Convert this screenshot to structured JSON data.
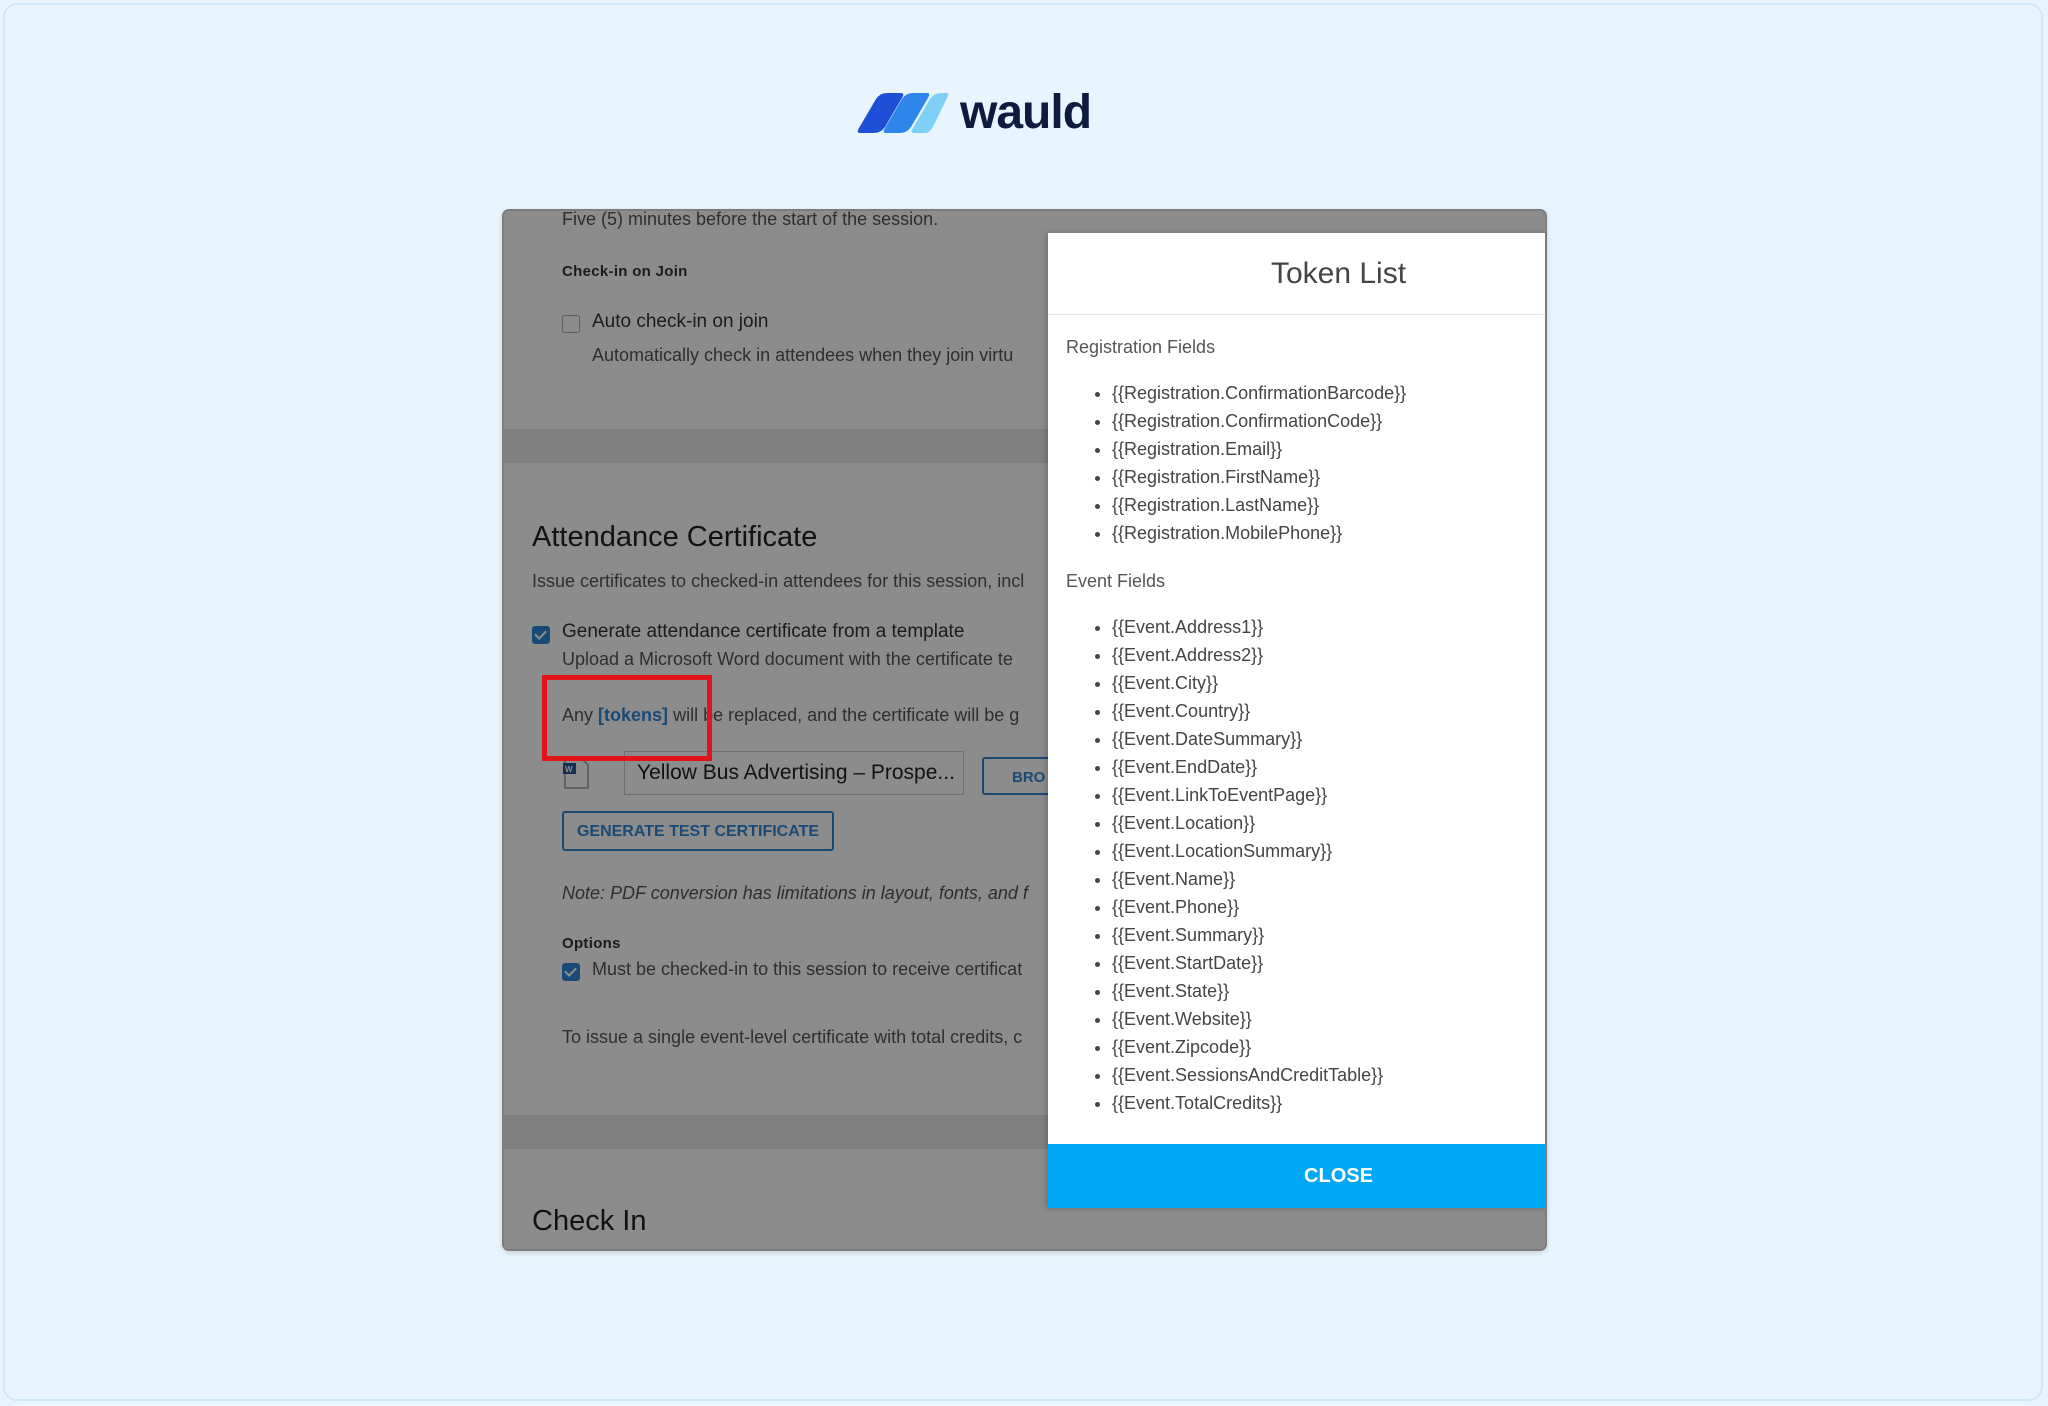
{
  "logo": {
    "text": "wauld"
  },
  "background": {
    "session_note": "Five (5) minutes before the start of the session.",
    "checkin_on_join_label": "Check-in on Join",
    "auto_checkin_label": "Auto check-in on join",
    "auto_checkin_desc": "Automatically check in attendees when they join virtu",
    "attendance_heading": "Attendance Certificate",
    "attendance_desc": "Issue certificates to checked-in attendees for this session, incl",
    "generate_template_label": "Generate attendance certificate from a template",
    "upload_desc": "Upload a Microsoft Word document with the certificate te",
    "tokens_any": "Any",
    "tokens_link": "[tokens]",
    "tokens_rest": "will be replaced, and the certificate will be g",
    "file_name": "Yellow Bus Advertising – Prospe...",
    "browse_label": "BRO",
    "generate_test_label": "GENERATE TEST CERTIFICATE",
    "note_text": "Note: PDF conversion has limitations in layout, fonts, and f",
    "options_label": "Options",
    "must_checkin_label": "Must be checked-in to this session to receive certificat",
    "event_level_text": "To issue a single event-level certificate with total credits, c",
    "checkin_heading": "Check In"
  },
  "modal": {
    "title": "Token List",
    "registration_label": "Registration Fields",
    "registration_tokens": [
      "{{Registration.ConfirmationBarcode}}",
      "{{Registration.ConfirmationCode}}",
      "{{Registration.Email}}",
      "{{Registration.FirstName}}",
      "{{Registration.LastName}}",
      "{{Registration.MobilePhone}}"
    ],
    "event_label": "Event Fields",
    "event_tokens": [
      "{{Event.Address1}}",
      "{{Event.Address2}}",
      "{{Event.City}}",
      "{{Event.Country}}",
      "{{Event.DateSummary}}",
      "{{Event.EndDate}}",
      "{{Event.LinkToEventPage}}",
      "{{Event.Location}}",
      "{{Event.LocationSummary}}",
      "{{Event.Name}}",
      "{{Event.Phone}}",
      "{{Event.Summary}}",
      "{{Event.StartDate}}",
      "{{Event.State}}",
      "{{Event.Website}}",
      "{{Event.Zipcode}}",
      "{{Event.SessionsAndCreditTable}}",
      "{{Event.TotalCredits}}"
    ],
    "close_label": "CLOSE"
  },
  "colors": {
    "accent": "#00a8f5",
    "highlight": "#e3131b",
    "link": "#2f88d8",
    "page_bg": "#e8f5fe"
  }
}
